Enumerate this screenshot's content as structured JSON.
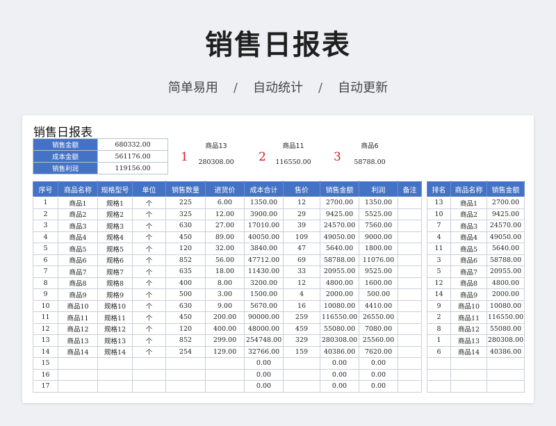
{
  "hero": {
    "title": "销售日报表",
    "tags": [
      "简单易用",
      "自动统计",
      "自动更新"
    ],
    "separator": "/"
  },
  "sheet": {
    "title": "销售日报表",
    "summary": [
      {
        "label": "销售金额",
        "value": "680332.00"
      },
      {
        "label": "成本金额",
        "value": "561176.00"
      },
      {
        "label": "销售利润",
        "value": "119156.00"
      }
    ],
    "top3": [
      {
        "rank": "1",
        "product": "商品13",
        "amount": "280308.00"
      },
      {
        "rank": "2",
        "product": "商品11",
        "amount": "116550.00"
      },
      {
        "rank": "3",
        "product": "商品6",
        "amount": "58788.00"
      }
    ],
    "main_table": {
      "headers": [
        "序号",
        "商品名称",
        "规格型号",
        "单位",
        "销售数量",
        "进货价",
        "成本合计",
        "售价",
        "销售金额",
        "利润",
        "备注"
      ],
      "rows": [
        [
          "1",
          "商品1",
          "规格1",
          "个",
          "225",
          "6.00",
          "1350.00",
          "12",
          "2700.00",
          "1350.00",
          ""
        ],
        [
          "2",
          "商品2",
          "规格2",
          "个",
          "325",
          "12.00",
          "3900.00",
          "29",
          "9425.00",
          "5525.00",
          ""
        ],
        [
          "3",
          "商品3",
          "规格3",
          "个",
          "630",
          "27.00",
          "17010.00",
          "39",
          "24570.00",
          "7560.00",
          ""
        ],
        [
          "4",
          "商品4",
          "规格4",
          "个",
          "450",
          "89.00",
          "40050.00",
          "109",
          "49050.00",
          "9000.00",
          ""
        ],
        [
          "5",
          "商品5",
          "规格5",
          "个",
          "120",
          "32.00",
          "3840.00",
          "47",
          "5640.00",
          "1800.00",
          ""
        ],
        [
          "6",
          "商品6",
          "规格6",
          "个",
          "852",
          "56.00",
          "47712.00",
          "69",
          "58788.00",
          "11076.00",
          ""
        ],
        [
          "7",
          "商品7",
          "规格7",
          "个",
          "635",
          "18.00",
          "11430.00",
          "33",
          "20955.00",
          "9525.00",
          ""
        ],
        [
          "8",
          "商品8",
          "规格8",
          "个",
          "400",
          "8.00",
          "3200.00",
          "12",
          "4800.00",
          "1600.00",
          ""
        ],
        [
          "9",
          "商品9",
          "规格9",
          "个",
          "500",
          "3.00",
          "1500.00",
          "4",
          "2000.00",
          "500.00",
          ""
        ],
        [
          "10",
          "商品10",
          "规格10",
          "个",
          "630",
          "9.00",
          "5670.00",
          "16",
          "10080.00",
          "4410.00",
          ""
        ],
        [
          "11",
          "商品11",
          "规格11",
          "个",
          "450",
          "200.00",
          "90000.00",
          "259",
          "116550.00",
          "26550.00",
          ""
        ],
        [
          "12",
          "商品12",
          "规格12",
          "个",
          "120",
          "400.00",
          "48000.00",
          "459",
          "55080.00",
          "7080.00",
          ""
        ],
        [
          "13",
          "商品13",
          "规格13",
          "个",
          "852",
          "299.00",
          "254748.00",
          "329",
          "280308.00",
          "25560.00",
          ""
        ],
        [
          "14",
          "商品14",
          "规格14",
          "个",
          "254",
          "129.00",
          "32766.00",
          "159",
          "40386.00",
          "7620.00",
          ""
        ],
        [
          "15",
          "",
          "",
          "",
          "",
          "",
          "0.00",
          "",
          "0.00",
          "0.00",
          ""
        ],
        [
          "16",
          "",
          "",
          "",
          "",
          "",
          "0.00",
          "",
          "0.00",
          "0.00",
          ""
        ],
        [
          "17",
          "",
          "",
          "",
          "",
          "",
          "0.00",
          "",
          "0.00",
          "0.00",
          ""
        ]
      ]
    },
    "rank_table": {
      "headers": [
        "排名",
        "商品名称",
        "销售金额"
      ],
      "rows": [
        [
          "13",
          "商品1",
          "2700.00"
        ],
        [
          "10",
          "商品2",
          "9425.00"
        ],
        [
          "7",
          "商品3",
          "24570.00"
        ],
        [
          "4",
          "商品4",
          "49050.00"
        ],
        [
          "11",
          "商品5",
          "5640.00"
        ],
        [
          "3",
          "商品6",
          "58788.00"
        ],
        [
          "5",
          "商品7",
          "20955.00"
        ],
        [
          "12",
          "商品8",
          "4800.00"
        ],
        [
          "14",
          "商品9",
          "2000.00"
        ],
        [
          "9",
          "商品10",
          "10080.00"
        ],
        [
          "2",
          "商品11",
          "116550.00"
        ],
        [
          "8",
          "商品12",
          "55080.00"
        ],
        [
          "1",
          "商品13",
          "280308.00"
        ],
        [
          "6",
          "商品14",
          "40386.00"
        ],
        [
          "",
          "",
          ""
        ],
        [
          "",
          "",
          ""
        ],
        [
          "",
          "",
          ""
        ]
      ]
    }
  }
}
